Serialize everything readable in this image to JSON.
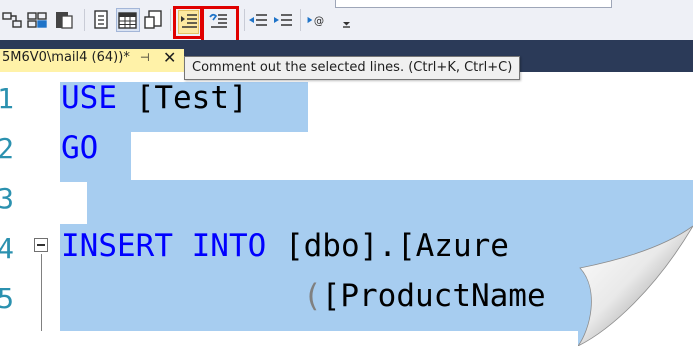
{
  "toolbar": {
    "icons": [
      {
        "name": "results-to-text-icon"
      },
      {
        "name": "results-to-grid-icon"
      },
      {
        "name": "results-to-file-icon"
      },
      {
        "name": "include-plan-icon"
      },
      {
        "name": "live-stats-icon"
      },
      {
        "name": "query-options-icon"
      },
      {
        "name": "comment-selection-icon"
      },
      {
        "name": "uncomment-selection-icon"
      },
      {
        "name": "decrease-indent-icon"
      },
      {
        "name": "increase-indent-icon"
      },
      {
        "name": "specify-template-values-icon"
      },
      {
        "name": "toolbar-overflow-icon"
      }
    ]
  },
  "tab": {
    "title": "5M6V0\\mail4 (64))*",
    "pin_glyph": "⊣",
    "close_glyph": "✕"
  },
  "tooltip": {
    "text": "Comment out the selected lines. (Ctrl+K, Ctrl+C)"
  },
  "editor": {
    "line_numbers": [
      "1",
      "2",
      "3",
      "4",
      "5"
    ],
    "lines": [
      {
        "keyword": "USE",
        "rest": " [Test]"
      },
      {
        "keyword": "GO",
        "rest": ""
      },
      {
        "keyword": "",
        "rest": ""
      },
      {
        "keyword": "INSERT INTO",
        "rest": " [dbo].[Azure"
      },
      {
        "keyword": "",
        "rest": "[ProductName"
      }
    ],
    "line5_paren": "("
  },
  "colors": {
    "highlight_red": "#e00000",
    "selection": "#a7cdf0",
    "keyword": "#0000ff",
    "line_number": "#2b91af",
    "tab_bar": "#2b3a58",
    "active_tab": "#fff2a8"
  }
}
